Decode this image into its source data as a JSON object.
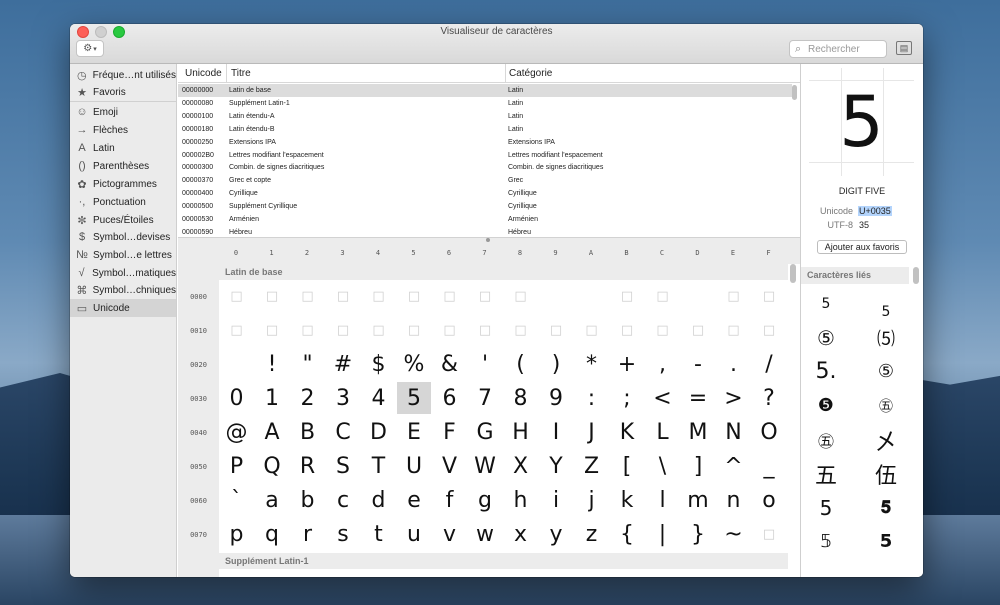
{
  "window": {
    "title": "Visualiseur de caractères",
    "search_placeholder": "Rechercher",
    "gear_icon": "gear-icon",
    "panel_icon": "sidebar-toggle-icon"
  },
  "sidebar": {
    "items": [
      {
        "icon": "◷",
        "icon_name": "clock-icon",
        "label": "Fréque…nt utilisés"
      },
      {
        "icon": "★",
        "icon_name": "star-icon",
        "label": "Favoris"
      },
      {
        "icon": "☺",
        "icon_name": "smiley-icon",
        "label": "Emoji"
      },
      {
        "icon": "→",
        "icon_name": "arrow-icon",
        "label": "Flèches"
      },
      {
        "icon": "A",
        "icon_name": "latin-icon",
        "label": "Latin"
      },
      {
        "icon": "()",
        "icon_name": "parentheses-icon",
        "label": "Parenthèses"
      },
      {
        "icon": "✿",
        "icon_name": "pictograph-icon",
        "label": "Pictogrammes"
      },
      {
        "icon": "·,",
        "icon_name": "punctuation-icon",
        "label": "Ponctuation"
      },
      {
        "icon": "✼",
        "icon_name": "bullet-icon",
        "label": "Puces/Étoiles"
      },
      {
        "icon": "$",
        "icon_name": "currency-icon",
        "label": "Symbol…devises"
      },
      {
        "icon": "№",
        "icon_name": "letterlike-icon",
        "label": "Symbol…e lettres"
      },
      {
        "icon": "√",
        "icon_name": "math-icon",
        "label": "Symbol…matiques"
      },
      {
        "icon": "⌘",
        "icon_name": "technical-icon",
        "label": "Symbol…chniques"
      },
      {
        "icon": "▭",
        "icon_name": "unicode-icon",
        "label": "Unicode"
      }
    ],
    "selected": "Unicode"
  },
  "blocks_table": {
    "columns": [
      "Unicode",
      "Titre",
      "Catégorie"
    ],
    "rows": [
      [
        "00000000",
        "Latin de base",
        "Latin"
      ],
      [
        "00000080",
        "Supplément Latin-1",
        "Latin"
      ],
      [
        "00000100",
        "Latin étendu-A",
        "Latin"
      ],
      [
        "00000180",
        "Latin étendu-B",
        "Latin"
      ],
      [
        "00000250",
        "Extensions IPA",
        "Extensions IPA"
      ],
      [
        "000002B0",
        "Lettres modifiant l'espacement",
        "Lettres modifiant l'espacement"
      ],
      [
        "00000300",
        "Combin. de signes diacritiques",
        "Combin. de signes diacritiques"
      ],
      [
        "00000370",
        "Grec et copte",
        "Grec"
      ],
      [
        "00000400",
        "Cyrillique",
        "Cyrillique"
      ],
      [
        "00000500",
        "Supplément Cyrillique",
        "Cyrillique"
      ],
      [
        "00000530",
        "Arménien",
        "Arménien"
      ],
      [
        "00000590",
        "Hébreu",
        "Hébreu"
      ]
    ]
  },
  "char_grid": {
    "hex_columns": [
      "0",
      "1",
      "2",
      "3",
      "4",
      "5",
      "6",
      "7",
      "8",
      "9",
      "A",
      "B",
      "C",
      "D",
      "E",
      "F"
    ],
    "section_title": "Latin de base",
    "next_section_title": "Supplément Latin-1",
    "rows": [
      {
        "label": "0000",
        "cells": [
          "□",
          "□",
          "□",
          "□",
          "□",
          "□",
          "□",
          "□",
          "□",
          "",
          "",
          "□",
          "□",
          "",
          "□",
          "□"
        ]
      },
      {
        "label": "0010",
        "cells": [
          "□",
          "□",
          "□",
          "□",
          "□",
          "□",
          "□",
          "□",
          "□",
          "□",
          "□",
          "□",
          "□",
          "□",
          "□",
          "□"
        ]
      },
      {
        "label": "0020",
        "cells": [
          "",
          "!",
          "\"",
          "#",
          "$",
          "%",
          "&",
          "'",
          "(",
          ")",
          "*",
          "+",
          ",",
          "-",
          ".",
          "/"
        ]
      },
      {
        "label": "0030",
        "cells": [
          "0",
          "1",
          "2",
          "3",
          "4",
          "5",
          "6",
          "7",
          "8",
          "9",
          ":",
          ";",
          "<",
          "=",
          ">",
          "?"
        ]
      },
      {
        "label": "0040",
        "cells": [
          "@",
          "A",
          "B",
          "C",
          "D",
          "E",
          "F",
          "G",
          "H",
          "I",
          "J",
          "K",
          "L",
          "M",
          "N",
          "O"
        ]
      },
      {
        "label": "0050",
        "cells": [
          "P",
          "Q",
          "R",
          "S",
          "T",
          "U",
          "V",
          "W",
          "X",
          "Y",
          "Z",
          "[",
          "\\",
          "]",
          "^",
          "_"
        ]
      },
      {
        "label": "0060",
        "cells": [
          "`",
          "a",
          "b",
          "c",
          "d",
          "e",
          "f",
          "g",
          "h",
          "i",
          "j",
          "k",
          "l",
          "m",
          "n",
          "o"
        ]
      },
      {
        "label": "0070",
        "cells": [
          "p",
          "q",
          "r",
          "s",
          "t",
          "u",
          "v",
          "w",
          "x",
          "y",
          "z",
          "{",
          "|",
          "}",
          "~",
          "□"
        ]
      }
    ],
    "selected_char": "5"
  },
  "inspector": {
    "glyph": "5",
    "name": "DIGIT FIVE",
    "unicode_label": "Unicode",
    "unicode_value": "U+0035",
    "utf8_label": "UTF-8",
    "utf8_value": "35",
    "add_favorite_label": "Ajouter aux favoris",
    "related_title": "Caractères liés",
    "related": [
      [
        "5",
        "5"
      ],
      [
        "⑤",
        "⑸"
      ],
      [
        "5.",
        "⑤"
      ],
      [
        "❺",
        "㊄"
      ],
      [
        "㊄",
        "㐅"
      ],
      [
        "五",
        "伍"
      ],
      [
        "5",
        "𝟓"
      ],
      [
        "𝟝",
        "𝟱"
      ]
    ]
  }
}
